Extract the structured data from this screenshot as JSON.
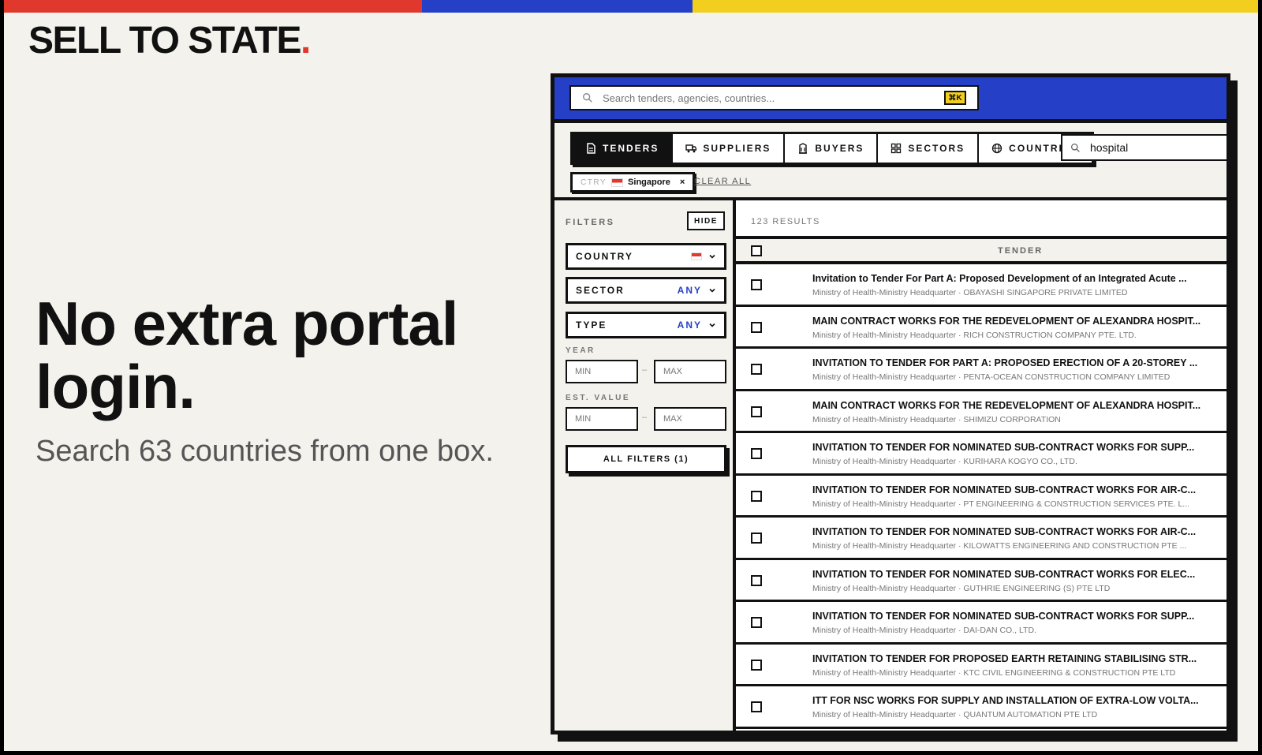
{
  "brand": {
    "logo_text": "SELL TO STATE",
    "logo_dot": ".",
    "stripe_colors": [
      "#e0382c",
      "#2540c7",
      "#f2cf1f"
    ]
  },
  "hero": {
    "title": "No extra portal login.",
    "subtitle": "Search 63 countries from one box."
  },
  "app": {
    "global_search": {
      "placeholder": "Search tenders, agencies, countries...",
      "shortcut": "⌘K"
    },
    "tabs": [
      {
        "label": "TENDERS",
        "icon": "document-icon",
        "active": true
      },
      {
        "label": "SUPPLIERS",
        "icon": "truck-icon",
        "active": false
      },
      {
        "label": "BUYERS",
        "icon": "building-icon",
        "active": false
      },
      {
        "label": "SECTORS",
        "icon": "grid-icon",
        "active": false
      },
      {
        "label": "COUNTRIES",
        "icon": "globe-icon",
        "active": false
      }
    ],
    "query": "hospital",
    "active_filter": {
      "key": "CTRY",
      "value": "Singapore"
    },
    "clear_all": "CLEAR ALL",
    "filters": {
      "label": "FILTERS",
      "hide": "HIDE",
      "country": {
        "label": "COUNTRY"
      },
      "sector": {
        "label": "SECTOR",
        "value": "ANY"
      },
      "type": {
        "label": "TYPE",
        "value": "ANY"
      },
      "year": {
        "label": "YEAR",
        "min_placeholder": "MIN",
        "max_placeholder": "MAX"
      },
      "est_value": {
        "label": "EST. VALUE",
        "min_placeholder": "MIN",
        "max_placeholder": "MAX"
      },
      "all_filters": "ALL FILTERS (1)"
    },
    "results": {
      "count": "123 RESULTS",
      "column_header": "TENDER",
      "rows": [
        {
          "title": "Invitation to Tender For Part A: Proposed Development of an Integrated Acute ...",
          "meta": "Ministry of Health-Ministry Headquarter · OBAYASHI SINGAPORE PRIVATE LIMITED"
        },
        {
          "title": "MAIN CONTRACT WORKS FOR THE REDEVELOPMENT OF ALEXANDRA HOSPIT...",
          "meta": "Ministry of Health-Ministry Headquarter · RICH CONSTRUCTION COMPANY PTE. LTD."
        },
        {
          "title": "INVITATION TO TENDER FOR PART A: PROPOSED ERECTION OF A 20-STOREY ...",
          "meta": "Ministry of Health-Ministry Headquarter · PENTA-OCEAN CONSTRUCTION COMPANY LIMITED"
        },
        {
          "title": "MAIN CONTRACT WORKS FOR THE REDEVELOPMENT OF ALEXANDRA HOSPIT...",
          "meta": "Ministry of Health-Ministry Headquarter · SHIMIZU CORPORATION"
        },
        {
          "title": "INVITATION TO TENDER FOR NOMINATED SUB-CONTRACT WORKS FOR SUPP...",
          "meta": "Ministry of Health-Ministry Headquarter · KURIHARA KOGYO CO., LTD."
        },
        {
          "title": "INVITATION TO TENDER FOR NOMINATED SUB-CONTRACT WORKS FOR AIR-C...",
          "meta": "Ministry of Health-Ministry Headquarter · PT ENGINEERING & CONSTRUCTION SERVICES PTE. L..."
        },
        {
          "title": "INVITATION TO TENDER FOR NOMINATED SUB-CONTRACT WORKS FOR AIR-C...",
          "meta": "Ministry of Health-Ministry Headquarter · KILOWATTS ENGINEERING AND CONSTRUCTION PTE ..."
        },
        {
          "title": "INVITATION TO TENDER FOR NOMINATED SUB-CONTRACT WORKS FOR ELEC...",
          "meta": "Ministry of Health-Ministry Headquarter · GUTHRIE ENGINEERING (S) PTE LTD"
        },
        {
          "title": "INVITATION TO TENDER FOR NOMINATED SUB-CONTRACT WORKS FOR SUPP...",
          "meta": "Ministry of Health-Ministry Headquarter · DAI-DAN CO., LTD."
        },
        {
          "title": "INVITATION TO TENDER FOR PROPOSED EARTH RETAINING STABILISING STR...",
          "meta": "Ministry of Health-Ministry Headquarter · KTC CIVIL ENGINEERING & CONSTRUCTION PTE LTD"
        },
        {
          "title": "ITT FOR NSC WORKS FOR SUPPLY AND INSTALLATION OF EXTRA-LOW VOLTA...",
          "meta": "Ministry of Health-Ministry Headquarter · QUANTUM AUTOMATION PTE LTD"
        }
      ]
    }
  }
}
